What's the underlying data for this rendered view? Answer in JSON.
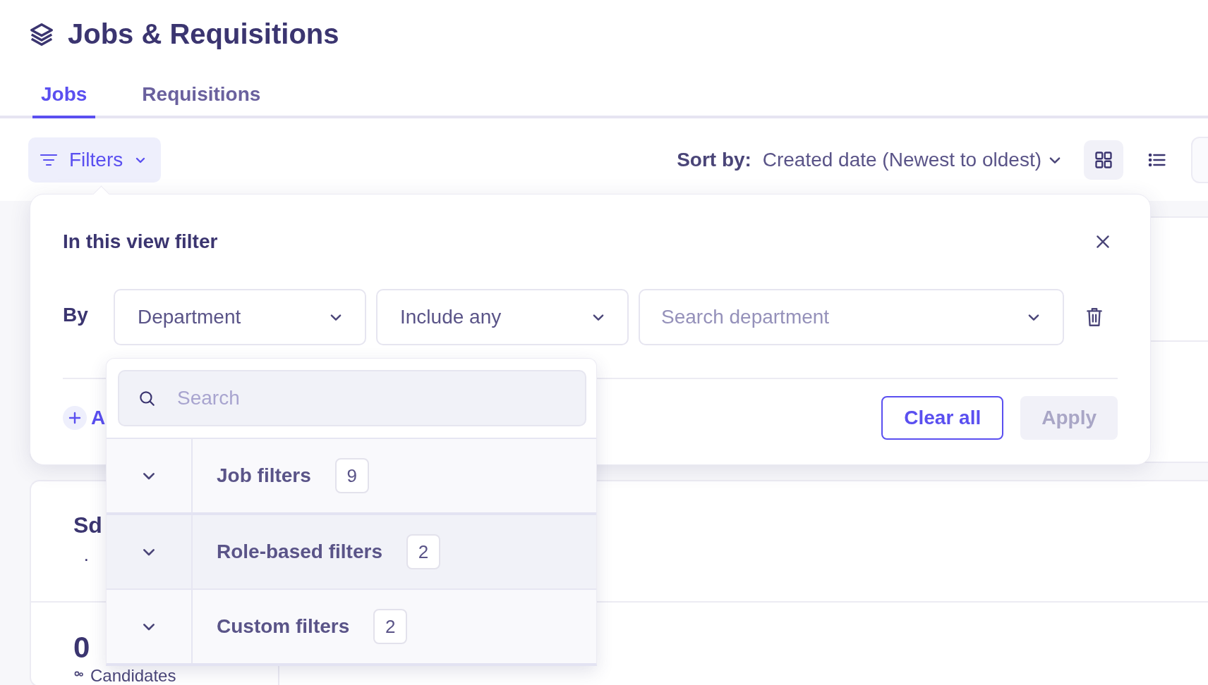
{
  "header": {
    "title": "Jobs & Requisitions"
  },
  "tabs": [
    {
      "label": "Jobs",
      "selected": true
    },
    {
      "label": "Requisitions",
      "selected": false
    }
  ],
  "toolbar": {
    "filters_button": "Filters",
    "sort_label": "Sort by:",
    "sort_value": "Created date (Newest to oldest)",
    "views": [
      {
        "kind": "grid",
        "selected": true
      },
      {
        "kind": "list",
        "selected": false
      }
    ]
  },
  "filter_panel": {
    "title": "In this view filter",
    "by_label": "By",
    "field": {
      "value": "Department"
    },
    "operator": {
      "value": "Include any"
    },
    "values": {
      "placeholder": "Search department"
    },
    "add_filter": "A",
    "buttons": [
      {
        "label": "Clear all",
        "kind": "outline"
      },
      {
        "label": "Apply",
        "kind": "disabled"
      }
    ]
  },
  "field_menu": {
    "search": {
      "placeholder": "Search"
    },
    "groups": [
      {
        "label": "Job filters",
        "count": "9",
        "expanded": false,
        "highlighted": false
      },
      {
        "label": "Role-based filters",
        "count": "2",
        "expanded": false,
        "highlighted": true
      },
      {
        "label": "Custom filters",
        "count": "2",
        "expanded": false,
        "highlighted": false
      }
    ]
  },
  "background_card": {
    "title": "Sd",
    "bullet": "·",
    "metric": {
      "value": "0",
      "label": "Candidates"
    }
  }
}
